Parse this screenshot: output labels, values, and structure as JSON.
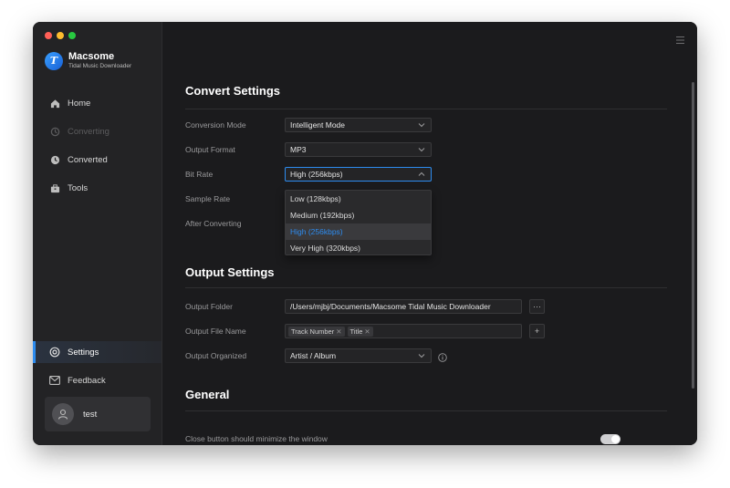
{
  "app": {
    "name": "Macsome",
    "subtitle": "Tidal Music Downloader",
    "logo_letter": "T"
  },
  "sidebar": {
    "items": [
      {
        "label": "Home",
        "icon": "home-icon",
        "state": "normal"
      },
      {
        "label": "Converting",
        "icon": "converting-icon",
        "state": "disabled"
      },
      {
        "label": "Converted",
        "icon": "clock-icon",
        "state": "normal"
      },
      {
        "label": "Tools",
        "icon": "toolbox-icon",
        "state": "normal"
      },
      {
        "label": "Settings",
        "icon": "gear-icon",
        "state": "active"
      },
      {
        "label": "Feedback",
        "icon": "mail-icon",
        "state": "normal"
      }
    ],
    "user": {
      "name": "test",
      "icon": "user-icon"
    }
  },
  "convert_settings": {
    "title": "Convert Settings",
    "conversion_mode": {
      "label": "Conversion Mode",
      "value": "Intelligent Mode"
    },
    "output_format": {
      "label": "Output Format",
      "value": "MP3"
    },
    "bit_rate": {
      "label": "Bit Rate",
      "value": "High (256kbps)",
      "options": [
        "Low (128kbps)",
        "Medium (192kbps)",
        "High (256kbps)",
        "Very High (320kbps)"
      ],
      "selected_index": 2
    },
    "sample_rate": {
      "label": "Sample Rate"
    },
    "after_converting": {
      "label": "After Converting"
    }
  },
  "output_settings": {
    "title": "Output Settings",
    "output_folder": {
      "label": "Output Folder",
      "value": "/Users/mjbj/Documents/Macsome Tidal Music Downloader",
      "browse_label": "···"
    },
    "output_file_name": {
      "label": "Output File Name",
      "tags": [
        "Track Number",
        "Title"
      ],
      "add_label": "+"
    },
    "output_organized": {
      "label": "Output Organized",
      "value": "Artist / Album",
      "info_icon": "info-icon"
    }
  },
  "general": {
    "title": "General",
    "close_button_minimize": {
      "label": "Close button should minimize the window",
      "enabled": true
    }
  },
  "colors": {
    "accent": "#2d8cf0",
    "background": "#1b1b1d",
    "sidebar": "#232325"
  }
}
